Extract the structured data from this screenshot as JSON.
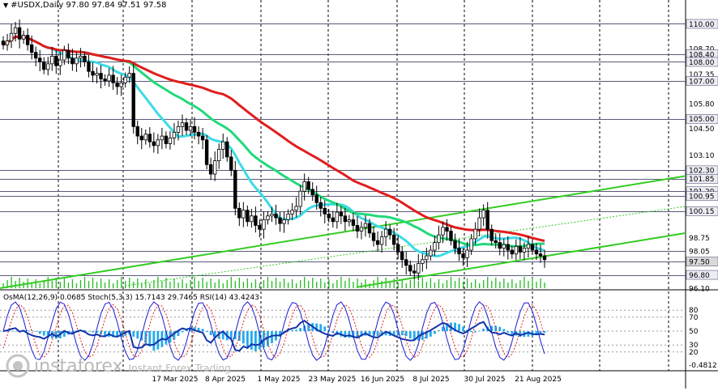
{
  "header": {
    "symbol": "#USDX,Daily",
    "ohlc": "97.80 97.84 97.51 97.58"
  },
  "indicators": {
    "osma_label": "OsMA(12,26,9)",
    "osma_value": "0.0685",
    "stoch_label": "Stoch(5,3,3)",
    "stoch_values": "15.7143 29.7465",
    "rsi_label": "RSI(14)",
    "rsi_value": "43.4243"
  },
  "watermark": {
    "brand": "instaforex",
    "tagline": "Instant Forex Trading"
  },
  "colors": {
    "candle": "#000000",
    "ma_fast": "#3ddbe6",
    "ma_mid": "#22d97a",
    "ma_slow": "#e11d1d",
    "channel": "#33cc22",
    "volume": "#22bb22",
    "osma_hist": "#22aaee",
    "stoch_main": "#1b1bd0",
    "stoch_signal": "#e11d1d",
    "rsi": "#1133aa",
    "grid": "#000000"
  },
  "chart_data": [
    {
      "type": "candlestick",
      "title": "#USDX,Daily",
      "x_tick_labels": [
        "17 Mar 2025",
        "8 Apr 2025",
        "1 May 2025",
        "23 May 2025",
        "16 Jun 2025",
        "8 Jul 2025",
        "30 Jul 2025",
        "21 Aug 2025"
      ],
      "y_tick_labels": [
        "110.00",
        "108.70",
        "108.40",
        "108.00",
        "107.35",
        "107.00",
        "105.80",
        "105.00",
        "104.50",
        "103.10",
        "102.30",
        "101.85",
        "101.20",
        "100.95",
        "100.15",
        "98.75",
        "98.05",
        "97.50",
        "96.80",
        "96.10"
      ],
      "price_levels": [
        110.0,
        108.4,
        108.0,
        107.0,
        105.0,
        102.3,
        101.85,
        101.2,
        100.95,
        100.15,
        98.06,
        97.5,
        96.8
      ],
      "ylim": [
        96.1,
        111.0
      ],
      "last_close": 97.58,
      "close_series": [
        108.9,
        109.1,
        109.5,
        109.8,
        109.2,
        109.4,
        108.9,
        108.5,
        108.2,
        108.0,
        107.6,
        107.9,
        108.3,
        107.8,
        108.1,
        108.6,
        108.2,
        107.9,
        108.2,
        108.3,
        108.0,
        107.5,
        107.3,
        107.4,
        107.1,
        107.0,
        107.3,
        106.9,
        106.7,
        106.9,
        107.2,
        107.4,
        104.6,
        104.1,
        103.9,
        104.2,
        103.8,
        103.6,
        103.9,
        104.1,
        103.7,
        104.0,
        104.3,
        104.6,
        104.8,
        104.4,
        104.6,
        104.3,
        104.1,
        103.9,
        102.6,
        102.1,
        102.8,
        103.4,
        103.8,
        103.0,
        102.3,
        100.3,
        99.8,
        100.2,
        99.6,
        99.9,
        99.4,
        99.2,
        99.7,
        99.9,
        100.0,
        99.8,
        99.5,
        99.7,
        100.0,
        100.2,
        100.4,
        101.2,
        101.7,
        101.3,
        101.0,
        100.6,
        100.3,
        100.0,
        99.8,
        99.6,
        100.1,
        99.9,
        99.6,
        99.7,
        99.4,
        99.1,
        99.3,
        99.5,
        99.0,
        98.6,
        98.4,
        98.8,
        99.2,
        98.9,
        98.4,
        98.0,
        97.6,
        97.3,
        97.0,
        96.9,
        97.4,
        97.6,
        97.8,
        98.1,
        98.5,
        98.9,
        99.3,
        99.1,
        98.6,
        98.2,
        97.9,
        97.7,
        98.1,
        98.7,
        99.2,
        99.8,
        100.2,
        99.2,
        98.6,
        98.5,
        98.2,
        98.4,
        98.1,
        97.9,
        98.3,
        98.0,
        98.2,
        98.4,
        98.1,
        97.9,
        97.8,
        97.6
      ],
      "moving_averages": [
        "fast (cyan)",
        "mid (green)",
        "slow (red)"
      ],
      "channel_lines": 3
    },
    {
      "type": "histogram+line",
      "title": "OsMA(12,26,9) 0.0685 Stoch(5,3,3) 15.7143 29.7465 RSI(14) 43.4243",
      "y_tick_labels": [
        "80",
        "70",
        "50",
        "30",
        "20",
        "-0.4812"
      ],
      "y_levels": [
        80,
        70,
        50,
        30,
        20
      ],
      "osma_last": 0.0685,
      "stoch_main_last": 15.7143,
      "stoch_signal_last": 29.7465,
      "rsi_last": 43.4243
    }
  ]
}
